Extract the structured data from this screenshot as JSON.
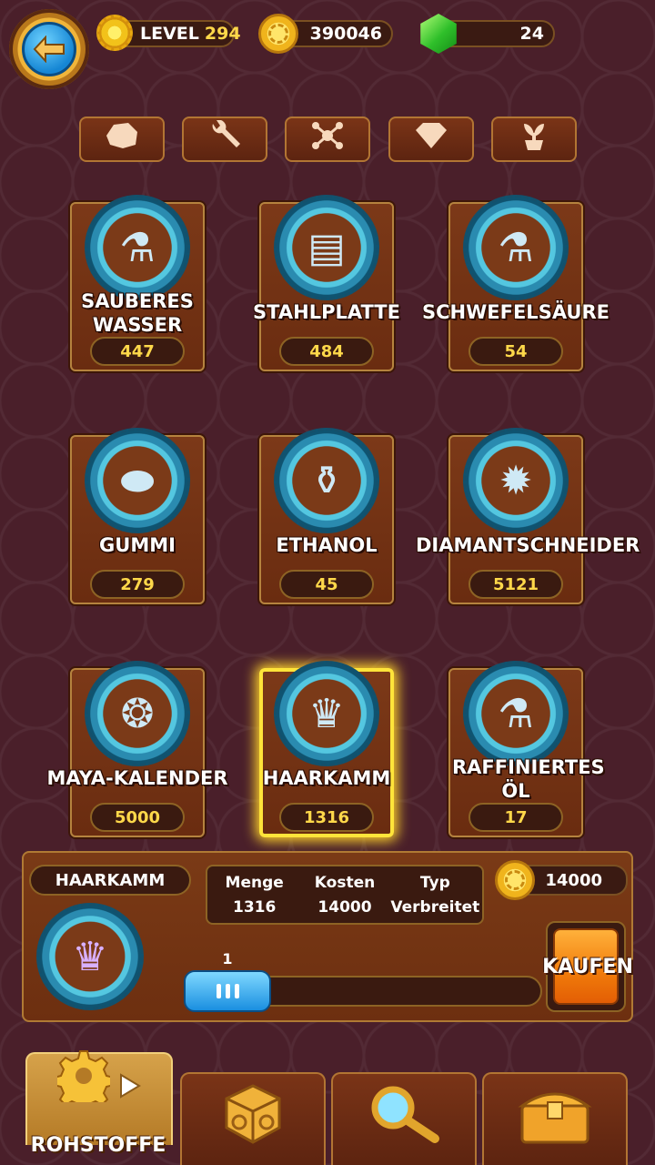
{
  "header": {
    "level_label": "LEVEL",
    "level_value": "294",
    "coins": "390046",
    "gems": "24"
  },
  "categories": [
    {
      "icon": "stone-icon"
    },
    {
      "icon": "wrench-icon"
    },
    {
      "icon": "molecule-icon"
    },
    {
      "icon": "diamond-icon"
    },
    {
      "icon": "plant-icon"
    }
  ],
  "items": [
    {
      "name": "SAUBERES WASSER",
      "qty": "447",
      "icon": "flask-blue-icon",
      "glyph": "⚗"
    },
    {
      "name": "STAHLPLATTE",
      "qty": "484",
      "icon": "steel-plates-icon",
      "glyph": "▤"
    },
    {
      "name": "SCHWEFELSÄURE",
      "qty": "54",
      "icon": "flask-yellow-icon",
      "glyph": "⚗"
    },
    {
      "name": "GUMMI",
      "qty": "279",
      "icon": "rubber-puck-icon",
      "glyph": "⬬"
    },
    {
      "name": "ETHANOL",
      "qty": "45",
      "icon": "bottle-icon",
      "glyph": "⚱"
    },
    {
      "name": "DIAMANTSCHNEIDER",
      "qty": "5121",
      "icon": "saw-blade-icon",
      "glyph": "✹"
    },
    {
      "name": "MAYA-KALENDER",
      "qty": "5000",
      "icon": "maya-calendar-icon",
      "glyph": "❂"
    },
    {
      "name": "HAARKAMM",
      "qty": "1316",
      "icon": "hair-comb-icon",
      "glyph": "♛"
    },
    {
      "name": "RAFFINIERTES ÖL",
      "qty": "17",
      "icon": "flask-oil-icon",
      "glyph": "⚗"
    }
  ],
  "selected": {
    "name": "HAARKAMM",
    "menge_label": "Menge",
    "menge_value": "1316",
    "kosten_label": "Kosten",
    "kosten_value": "14000",
    "typ_label": "Typ",
    "typ_value": "Verbreitet",
    "price": "14000",
    "slider_value": "1",
    "buy_label": "KAUFEN"
  },
  "bottom_nav": {
    "active_label": "ROHSTOFFE",
    "tabs": [
      {
        "icon": "gear-icon"
      },
      {
        "icon": "cube-icon"
      },
      {
        "icon": "magnifier-icon"
      },
      {
        "icon": "chest-icon"
      }
    ]
  },
  "colors": {
    "background": "#4a1f2a",
    "accent_gold": "#ffd84a",
    "selection_glow": "#ffe43a",
    "buy_orange": "#f07a0a"
  }
}
